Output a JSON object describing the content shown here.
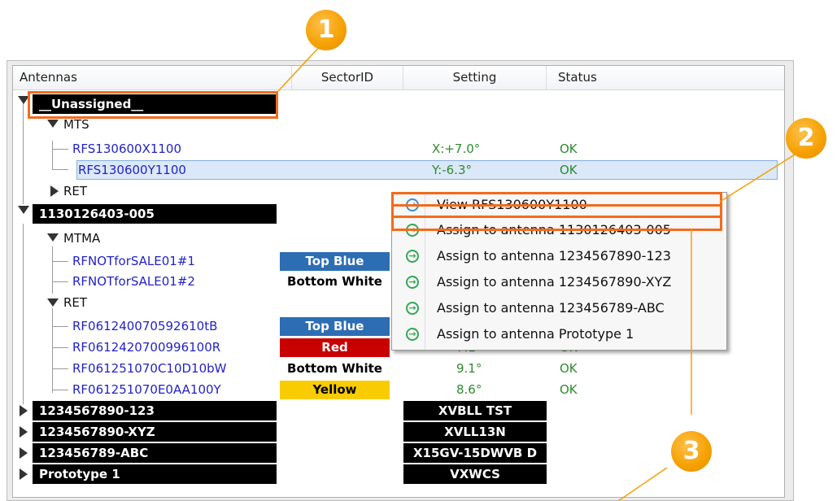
{
  "header": {
    "col_antennas": "Antennas",
    "col_sector": "SectorID",
    "col_setting": "Setting",
    "col_status": "Status"
  },
  "tree": {
    "unassigned": {
      "label": "__Unassigned__",
      "mts": {
        "label": "MTS",
        "items": [
          {
            "name": "RFS130600X1100",
            "setting": "X:+7.0°",
            "status": "OK"
          },
          {
            "name": "RFS130600Y1100",
            "setting": "Y:-6.3°",
            "status": "OK"
          }
        ]
      },
      "ret": {
        "label": "RET"
      }
    },
    "antenna1": {
      "label": "1130126403-005",
      "mtma": {
        "label": "MTMA",
        "items": [
          {
            "name": "RFNOTforSALE01#1",
            "tag": "Top Blue"
          },
          {
            "name": "RFNOTforSALE01#2",
            "tag": "Bottom White"
          }
        ]
      },
      "ret": {
        "label": "RET",
        "items": [
          {
            "name": "RF061240070592610tB",
            "tag": "Top Blue"
          },
          {
            "name": "RF0612420700996100R",
            "tag": "Red",
            "setting": "7.1°",
            "status": "OK"
          },
          {
            "name": "RF061251070C10D10bW",
            "tag": "Bottom White",
            "setting": "9.1°",
            "status": "OK"
          },
          {
            "name": "RF061251070E0AA100Y",
            "tag": "Yellow",
            "setting": "8.6°",
            "status": "OK"
          }
        ]
      }
    },
    "others": [
      {
        "label": "1234567890-123",
        "setting": "XVBLL TST"
      },
      {
        "label": "1234567890-XYZ",
        "setting": "XVLL13N"
      },
      {
        "label": "123456789-ABC",
        "setting": "X15GV-15DWVB D"
      },
      {
        "label": "Prototype 1",
        "setting": "VXWCS"
      }
    ]
  },
  "context_menu": {
    "items": [
      {
        "label": "View RFS130600Y1100",
        "icon": "view-arrow-icon"
      },
      {
        "label": "Assign to antenna 1130126403-005",
        "icon": "assign-arrow-icon"
      },
      {
        "label": "Assign to antenna 1234567890-123",
        "icon": "assign-arrow-icon"
      },
      {
        "label": "Assign to antenna 1234567890-XYZ",
        "icon": "assign-arrow-icon"
      },
      {
        "label": "Assign to antenna 123456789-ABC",
        "icon": "assign-arrow-icon"
      },
      {
        "label": "Assign to antenna Prototype 1",
        "icon": "assign-arrow-icon"
      }
    ]
  },
  "callouts": [
    "1",
    "2",
    "3"
  ],
  "colors": {
    "highlight": "#f26b1d",
    "callout": "#f5a000",
    "link_blue": "#2323c8",
    "ok_green": "#2e8b2e"
  }
}
